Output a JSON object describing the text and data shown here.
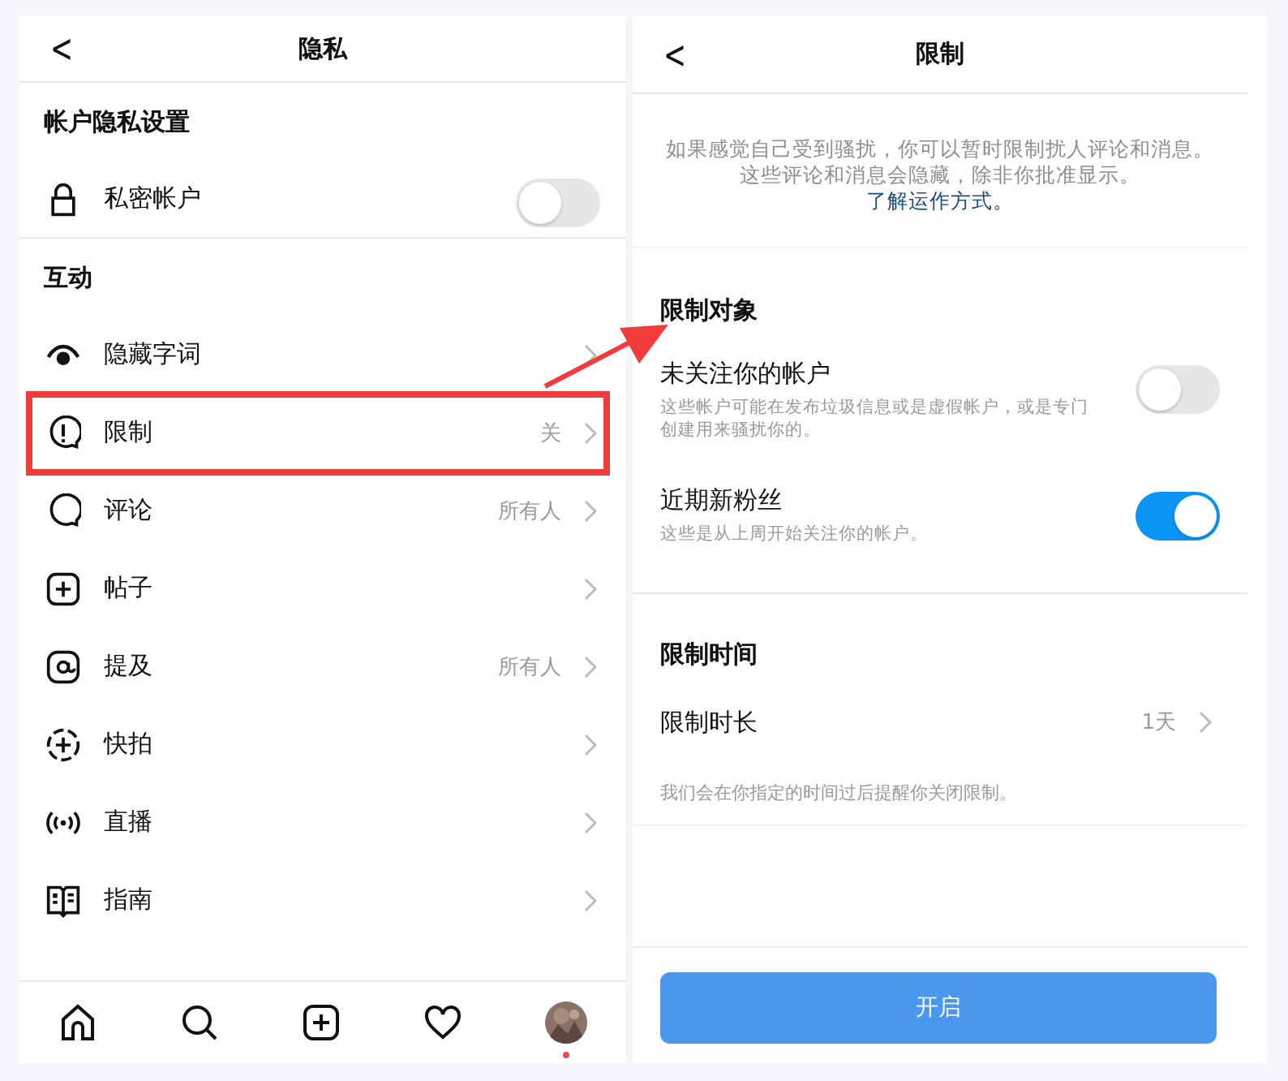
{
  "privacy_screen": {
    "back_glyph": "<",
    "title": "隐私",
    "account_section": {
      "heading": "帐户隐私设置",
      "private_account": {
        "label": "私密帐户",
        "on": false
      }
    },
    "interactions": {
      "heading": "互动",
      "rows": [
        {
          "label": "隐藏字词",
          "highlighted": false
        },
        {
          "label": "限制",
          "value": "关",
          "highlighted": true
        },
        {
          "label": "评论",
          "value": "所有人",
          "highlighted": false
        },
        {
          "label": "帖子",
          "highlighted": false
        },
        {
          "label": "提及",
          "value": "所有人",
          "highlighted": false
        },
        {
          "label": "快拍",
          "highlighted": false
        },
        {
          "label": "直播",
          "highlighted": false
        },
        {
          "label": "指南",
          "highlighted": false
        }
      ]
    },
    "tab_bar": {
      "profile_notification": true
    }
  },
  "restrict_screen": {
    "back_glyph": "<",
    "title": "限制",
    "description": "如果感觉自己受到骚扰，你可以暂时限制扰人评论和消息。这些评论和消息会隐藏，除非你批准显示。",
    "learn_link": "了解运作方式。",
    "targets": {
      "heading": "限制对象",
      "options": [
        {
          "label": "未关注你的帐户",
          "detail": "这些帐户可能在发布垃圾信息或是虚假帐户，或是专门创建用来骚扰你的。",
          "on": false
        },
        {
          "label": "近期新粉丝",
          "detail": "这些是从上周开始关注你的帐户。",
          "on": true
        }
      ]
    },
    "duration": {
      "heading": "限制时间",
      "label": "限制时长",
      "value": "1天",
      "note": "我们会在你指定的时间过后提醒你关闭限制。"
    },
    "submit_button": "开启"
  }
}
